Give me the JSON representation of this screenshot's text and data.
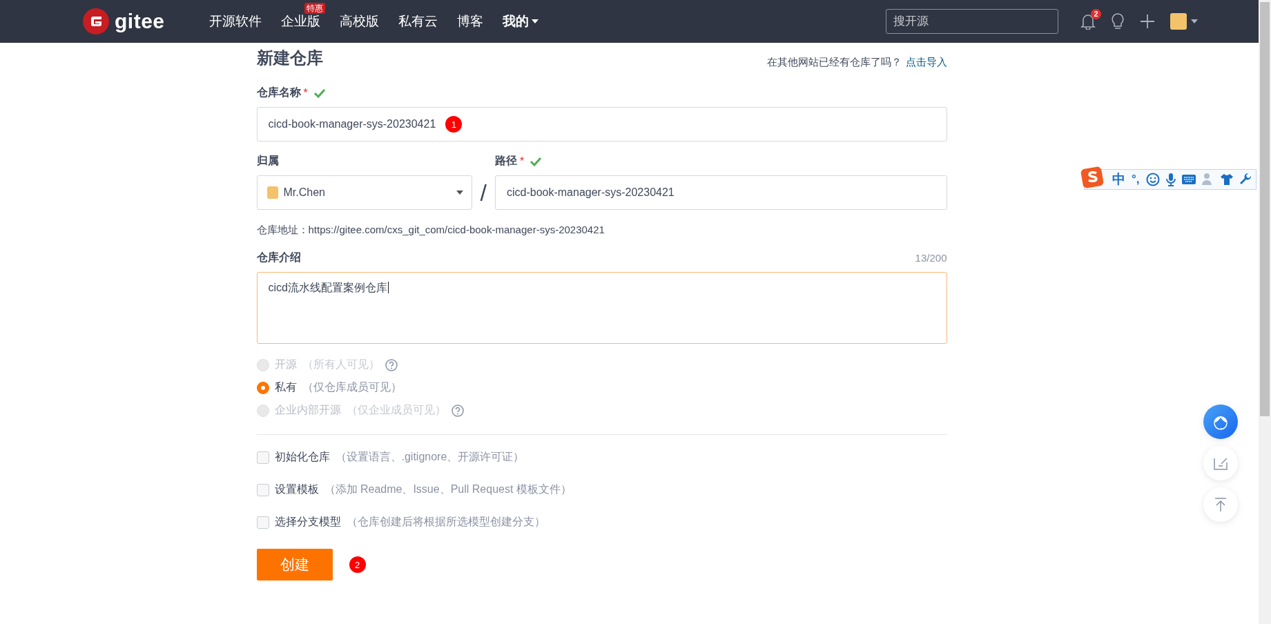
{
  "nav": {
    "logo_text": "gitee",
    "items": [
      {
        "label": "开源软件",
        "bold": false
      },
      {
        "label": "企业版",
        "badge": "特惠",
        "bold": false
      },
      {
        "label": "高校版",
        "bold": false
      },
      {
        "label": "私有云",
        "bold": false
      },
      {
        "label": "博客",
        "bold": false
      },
      {
        "label": "我的",
        "bold": true
      }
    ],
    "search": {
      "placeholder": "搜开源"
    },
    "notification_count": "2"
  },
  "page": {
    "title": "新建仓库",
    "import_prompt": "在其他网站已经有仓库了吗？",
    "import_link": "点击导入"
  },
  "repo_name": {
    "label": "仓库名称",
    "required": "*",
    "valid": true,
    "value": "cicd-book-manager-sys-20230421",
    "annotation": "1"
  },
  "owner": {
    "label": "归属",
    "value": "Mr.Chen"
  },
  "separator": "/",
  "path": {
    "label": "路径",
    "required": "*",
    "valid": true,
    "value": "cicd-book-manager-sys-20230421"
  },
  "address": "仓库地址：https://gitee.com/cxs_git_com/cicd-book-manager-sys-20230421",
  "description": {
    "label": "仓库介绍",
    "counter": "13/200",
    "value": "cicd流水线配置案例仓库"
  },
  "visibility": [
    {
      "label": "开源",
      "note": "（所有人可见）",
      "selected": false,
      "disabled": true,
      "help": true
    },
    {
      "label": "私有",
      "note": "（仅仓库成员可见）",
      "selected": true,
      "disabled": false,
      "help": false
    },
    {
      "label": "企业内部开源",
      "note": "（仅企业成员可见）",
      "selected": false,
      "disabled": true,
      "help": true
    }
  ],
  "options": [
    {
      "label": "初始化仓库",
      "note": "（设置语言、.gitignore、开源许可证）",
      "checked": false
    },
    {
      "label": "设置模板",
      "note": "（添加 Readme、Issue、Pull Request 模板文件）",
      "checked": false
    },
    {
      "label": "选择分支模型",
      "note": "（仓库创建后将根据所选模型创建分支）",
      "checked": false
    }
  ],
  "submit": {
    "label": "创建",
    "annotation": "2"
  },
  "ime_toolbar": {
    "mode": "中",
    "punctuation": "°,"
  }
}
